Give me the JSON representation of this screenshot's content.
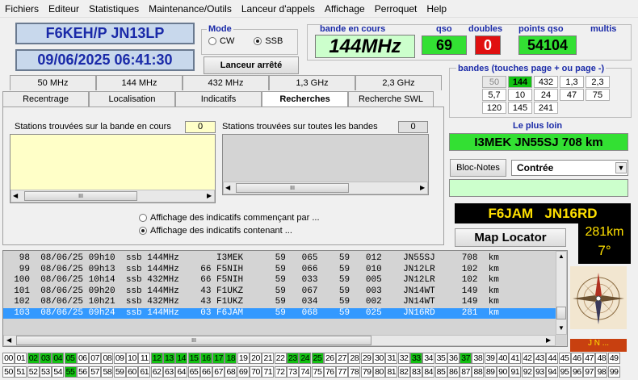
{
  "menu": [
    "Fichiers",
    "Editeur",
    "Statistiques",
    "Maintenance/Outils",
    "Lanceur d'appels",
    "Affichage",
    "Perroquet",
    "Help"
  ],
  "header": {
    "callsign_locator": "F6KEH/P  JN13LP",
    "datetime": "09/06/2025   06:41:30"
  },
  "mode": {
    "legend": "Mode",
    "cw": "CW",
    "ssb": "SSB",
    "selected": "SSB"
  },
  "launcher_button": "Lanceur arrêté",
  "band": {
    "label": "bande en cours",
    "value": "144MHz"
  },
  "qso": {
    "label": "qso",
    "value": "69"
  },
  "doubles": {
    "label": "doubles",
    "value": "0"
  },
  "points": {
    "label": "points qso",
    "value": "54104"
  },
  "multis": {
    "label": "multis"
  },
  "bands_tabs": [
    "50 MHz",
    "144 MHz",
    "432 MHz",
    "1,3 GHz",
    "2,3 GHz"
  ],
  "function_tabs": [
    "Recentrage",
    "Localisation",
    "Indicatifs",
    "Recherches",
    "Recherche SWL"
  ],
  "active_tab": "Recherches",
  "search": {
    "band_label": "Stations trouvées sur la bande en cours",
    "band_count": "0",
    "all_label": "Stations trouvées sur toutes les bandes",
    "all_count": "0",
    "scroll_grip": "III",
    "opt_start": "Affichage des indicatifs commençant par ...",
    "opt_contain": "Affichage des indicatifs contenant ...",
    "selected": "contain"
  },
  "bandes": {
    "label": "bandes (touches page + ou page -)",
    "cells": [
      "50",
      "144",
      "432",
      "1,3",
      "2,3",
      "5,7",
      "10",
      "24",
      "47",
      "75",
      "120",
      "145",
      "241"
    ],
    "active": "144"
  },
  "farthest": {
    "label": "Le plus loin",
    "value": "I3MEK JN55SJ  708 km"
  },
  "notes": {
    "button": "Bloc-Notes",
    "select": "Contrée"
  },
  "last": {
    "station": "F6JAM   JN16RD",
    "distance": "281km",
    "bearing": "7°"
  },
  "map_button": "Map Locator",
  "compass_label": "J N ...",
  "log": [
    "   98  08/06/25 09h10  ssb 144MHz       I3MEK      59   065    59   012    JN55SJ     708  km",
    "   99  08/06/25 09h13  ssb 144MHz    66 F5NIH      59   066    59   010    JN12LR     102  km",
    "  100  08/06/25 10h14  ssb 432MHz    66 F5NIH      59   033    59   005    JN12LR     102  km",
    "  101  08/06/25 09h20  ssb 144MHz    43 F1UKZ      59   067    59   003    JN14WT     149  km",
    "  102  08/06/25 10h21  ssb 432MHz    43 F1UKZ      59   034    59   002    JN14WT     149  km",
    "  103  08/06/25 09h24  ssb 144MHz    03 F6JAM      59   068    59   025    JN16RD     281  km"
  ],
  "log_scroll_grip": "III",
  "locator_grid": {
    "row1": [
      "00",
      "01",
      "02",
      "03",
      "04",
      "05",
      "06",
      "07",
      "08",
      "09",
      "10",
      "11",
      "12",
      "13",
      "14",
      "15",
      "16",
      "17",
      "18",
      "19",
      "20",
      "21",
      "22",
      "23",
      "24",
      "25",
      "26",
      "27",
      "28",
      "29",
      "30",
      "31",
      "32",
      "33",
      "34",
      "35",
      "36",
      "37",
      "38",
      "39",
      "40",
      "41",
      "42",
      "43",
      "44",
      "45",
      "46",
      "47",
      "48",
      "49"
    ],
    "row2": [
      "50",
      "51",
      "52",
      "53",
      "54",
      "55",
      "56",
      "57",
      "58",
      "59",
      "60",
      "61",
      "62",
      "63",
      "64",
      "65",
      "66",
      "67",
      "68",
      "69",
      "70",
      "71",
      "72",
      "73",
      "74",
      "75",
      "76",
      "77",
      "78",
      "79",
      "80",
      "81",
      "82",
      "83",
      "84",
      "85",
      "86",
      "87",
      "88",
      "89",
      "90",
      "91",
      "92",
      "93",
      "94",
      "95",
      "96",
      "97",
      "98",
      "99"
    ],
    "green": [
      "02",
      "03",
      "04",
      "05",
      "12",
      "13",
      "14",
      "15",
      "16",
      "17",
      "18",
      "23",
      "24",
      "25",
      "33",
      "37",
      "55"
    ]
  },
  "colors": {
    "accent_blue": "#1a2aa8",
    "green": "#12c212",
    "red": "#e01010",
    "selection": "#3399ff",
    "yellow": "#ffffc8",
    "lightgreen": "#ccffcc"
  }
}
